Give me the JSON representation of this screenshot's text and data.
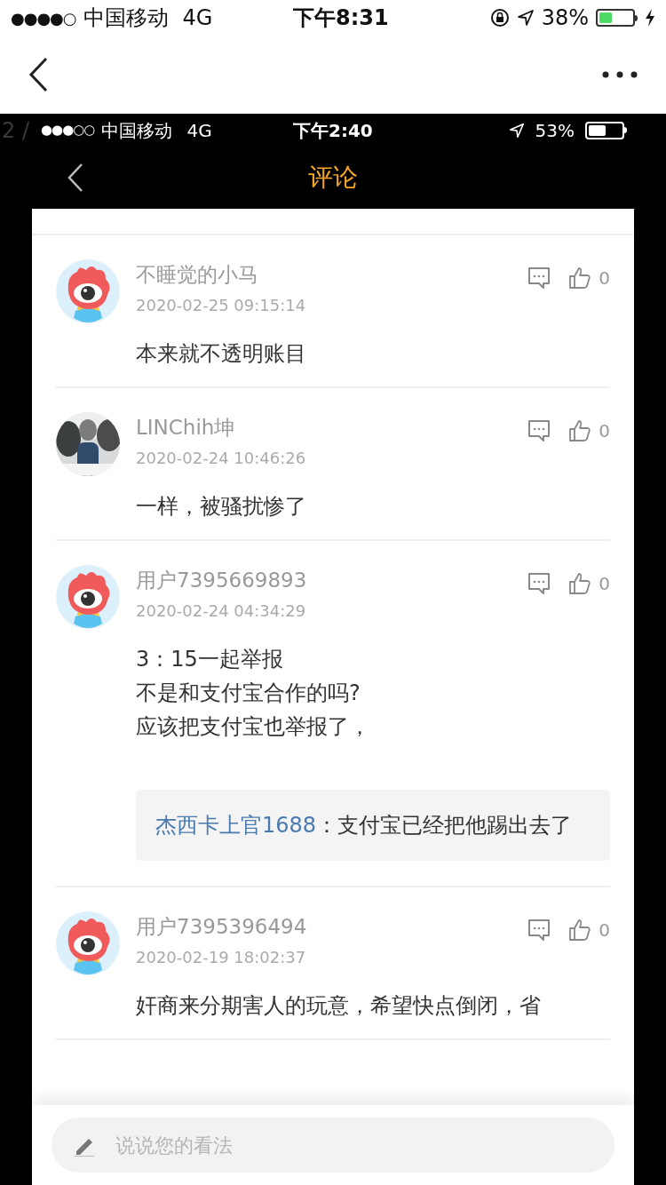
{
  "outer_status_bar": {
    "signal": "●●●●○",
    "carrier": "中国移动",
    "network": "4G",
    "time": "下午8:31",
    "battery": "38%"
  },
  "viewer": {
    "page_indicator": "2 /"
  },
  "inner_status_bar": {
    "signal": "●●●○○",
    "carrier": "中国移动",
    "network": "4G",
    "time": "下午2:40",
    "battery": "53%"
  },
  "inner_nav": {
    "title": "评论"
  },
  "comments": [
    {
      "kind": "default",
      "name": "不睡觉的小马",
      "time": "2020-02-25 09:15:14",
      "likes": "0",
      "lines": [
        "本来就不透明账目"
      ]
    },
    {
      "kind": "picture",
      "name": "LINChih坤",
      "time": "2020-02-24 10:46:26",
      "likes": "0",
      "lines": [
        "一样，被骚扰惨了"
      ]
    },
    {
      "kind": "default",
      "name": "用户7395669893",
      "time": "2020-02-24 04:34:29",
      "likes": "0",
      "lines": [
        "3：15一起举报",
        "不是和支付宝合作的吗?",
        "应该把支付宝也举报了，"
      ],
      "reply": {
        "user": "杰西卡上官1688",
        "text": "：支付宝已经把他踢出去了"
      }
    },
    {
      "kind": "default",
      "name": "用户7395396494",
      "time": "2020-02-19 18:02:37",
      "likes": "0",
      "lines": [
        "奸商来分期害人的玩意，希望快点倒闭，省"
      ]
    }
  ],
  "input": {
    "placeholder": "说说您的看法"
  }
}
